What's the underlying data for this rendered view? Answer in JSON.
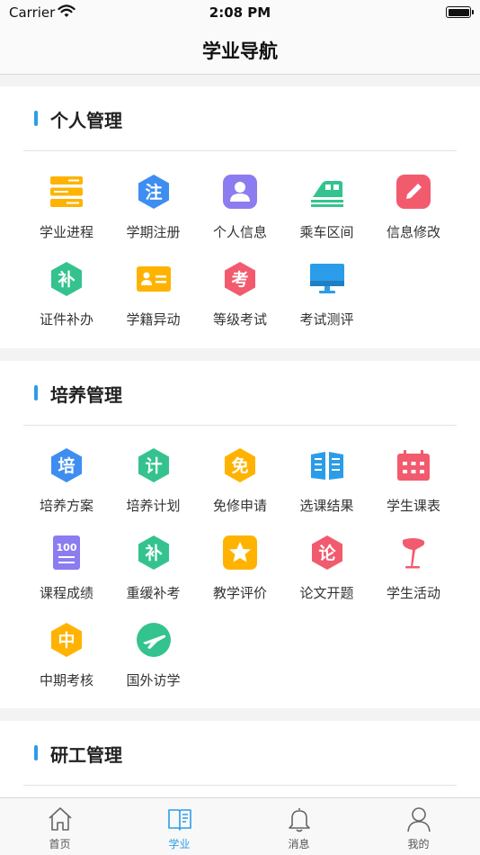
{
  "status_bar": {
    "carrier": "Carrier",
    "time": "2:08 PM"
  },
  "nav": {
    "title": "学业导航"
  },
  "sections": [
    {
      "title": "个人管理",
      "items": [
        {
          "label": "学业进程",
          "icon": "progress-bars-icon",
          "color": "#ffb300"
        },
        {
          "label": "学期注册",
          "icon": "register-hex-icon",
          "glyph": "注",
          "color": "#3d8ef0"
        },
        {
          "label": "个人信息",
          "icon": "person-icon",
          "color": "#8b7cf0"
        },
        {
          "label": "乘车区间",
          "icon": "train-icon",
          "color": "#34c38f"
        },
        {
          "label": "信息修改",
          "icon": "edit-pencil-icon",
          "color": "#f25a6e"
        },
        {
          "label": "证件补办",
          "icon": "replace-hex-icon",
          "glyph": "补",
          "color": "#34c38f"
        },
        {
          "label": "学籍异动",
          "icon": "id-card-icon",
          "color": "#ffb300"
        },
        {
          "label": "等级考试",
          "icon": "exam-hex-icon",
          "glyph": "考",
          "color": "#f25a6e"
        },
        {
          "label": "考试测评",
          "icon": "monitor-icon",
          "color": "#2b9de8"
        }
      ]
    },
    {
      "title": "培养管理",
      "items": [
        {
          "label": "培养方案",
          "icon": "training-hex-icon",
          "glyph": "培",
          "color": "#3d8ef0"
        },
        {
          "label": "培养计划",
          "icon": "plan-hex-icon",
          "glyph": "计",
          "color": "#34c38f"
        },
        {
          "label": "免修申请",
          "icon": "exempt-hex-icon",
          "glyph": "免",
          "color": "#ffb300"
        },
        {
          "label": "选课结果",
          "icon": "open-book-icon",
          "color": "#2b9de8"
        },
        {
          "label": "学生课表",
          "icon": "calendar-icon",
          "color": "#f25a6e"
        },
        {
          "label": "课程成绩",
          "icon": "score-100-icon",
          "glyph": "100",
          "color": "#8b7cf0"
        },
        {
          "label": "重缓补考",
          "icon": "makeup-hex-icon",
          "glyph": "补",
          "color": "#34c38f"
        },
        {
          "label": "教学评价",
          "icon": "star-icon",
          "color": "#ffb300"
        },
        {
          "label": "论文开题",
          "icon": "thesis-hex-icon",
          "glyph": "论",
          "color": "#f25a6e"
        },
        {
          "label": "学生活动",
          "icon": "flag-icon",
          "color": "#f25a6e"
        },
        {
          "label": "中期考核",
          "icon": "midterm-hex-icon",
          "glyph": "中",
          "color": "#ffb300"
        },
        {
          "label": "国外访学",
          "icon": "airplane-icon",
          "color": "#34c38f"
        }
      ]
    },
    {
      "title": "研工管理",
      "items": []
    }
  ],
  "tabs": [
    {
      "label": "首页",
      "icon": "home-icon",
      "active": false
    },
    {
      "label": "学业",
      "icon": "book-icon",
      "active": true
    },
    {
      "label": "消息",
      "icon": "bell-icon",
      "active": false
    },
    {
      "label": "我的",
      "icon": "profile-icon",
      "active": false
    }
  ],
  "colors": {
    "accent": "#2b9de8",
    "background": "#f3f3f3"
  }
}
